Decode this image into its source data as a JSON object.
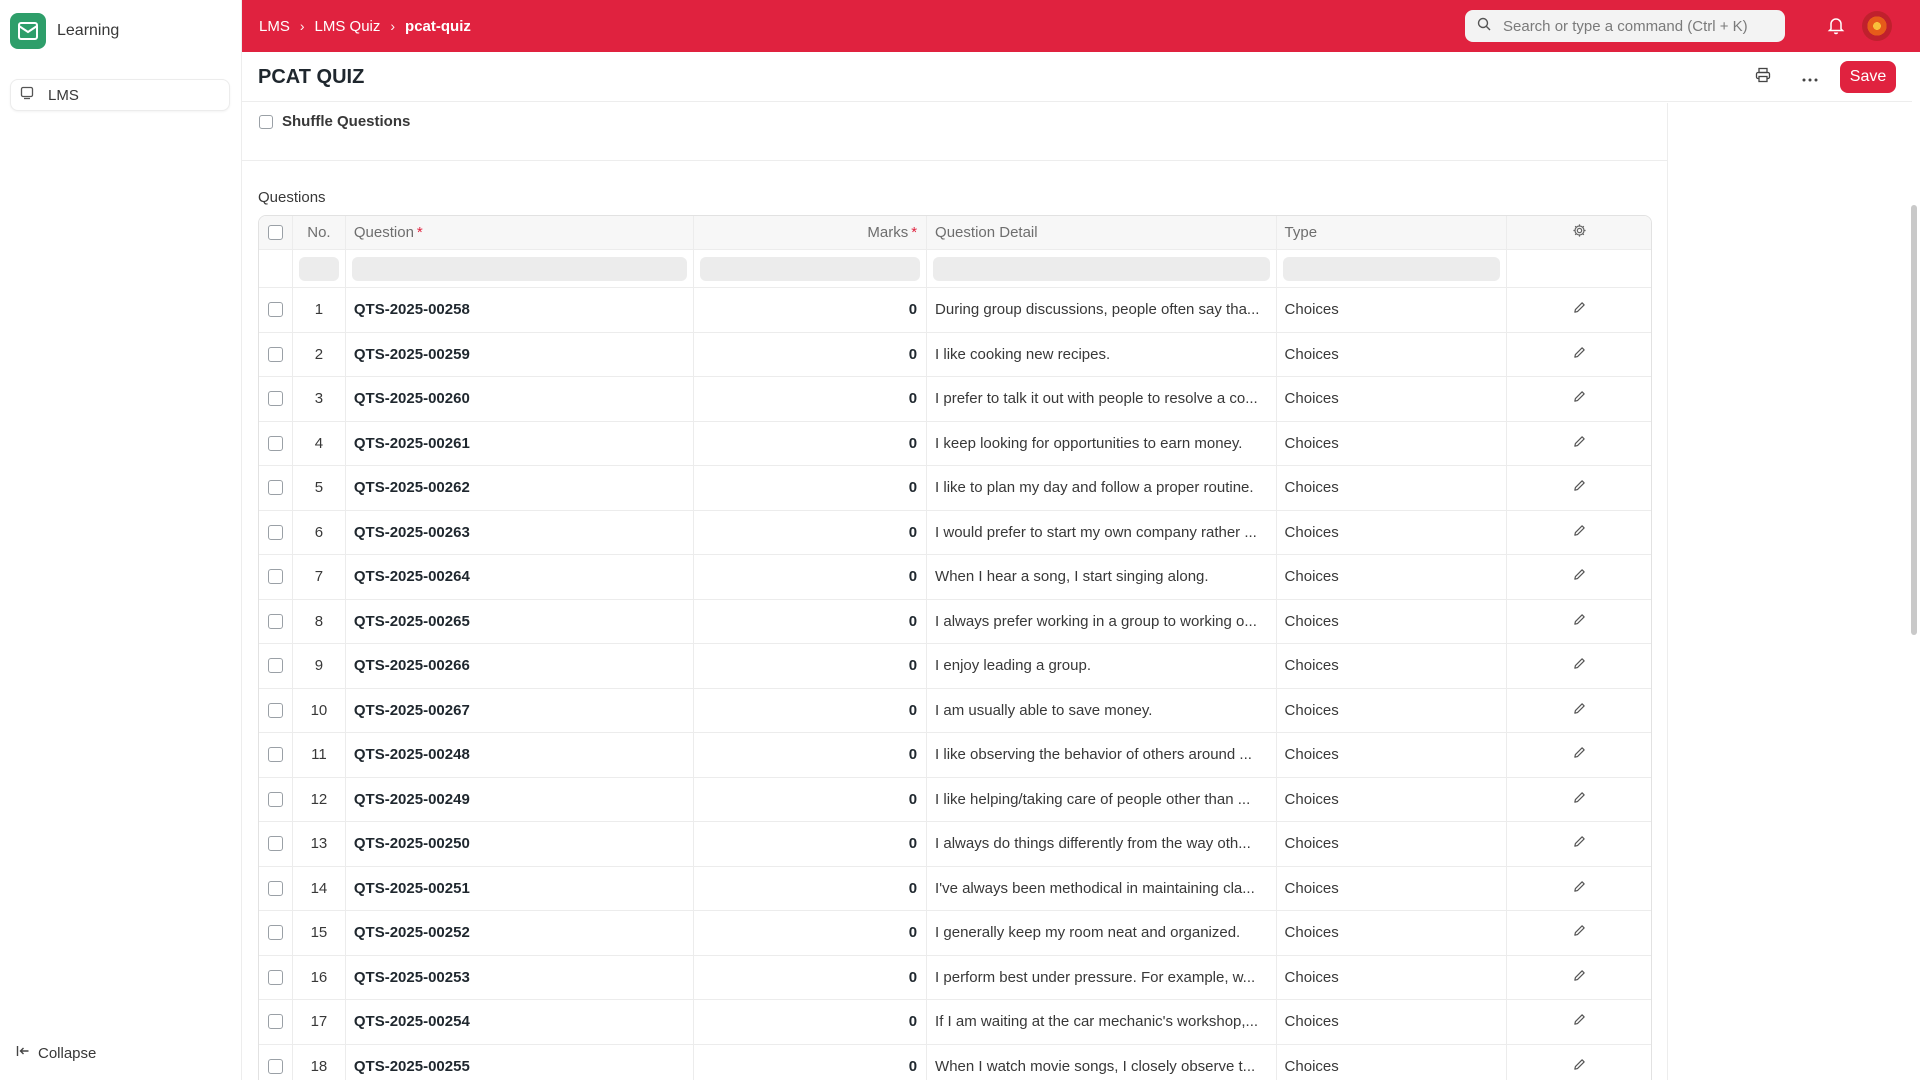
{
  "app": {
    "name": "Learning"
  },
  "sidebar": {
    "items": [
      {
        "label": "LMS",
        "icon": "workspace-icon"
      }
    ],
    "collapse_label": "Collapse"
  },
  "topbar": {
    "breadcrumb": [
      "LMS",
      "LMS Quiz",
      "pcat-quiz"
    ],
    "search_placeholder": "Search or type a command (Ctrl + K)",
    "accent_color": "#e0223f"
  },
  "page": {
    "title": "PCAT QUIZ",
    "save_label": "Save"
  },
  "form": {
    "shuffle_label": "Shuffle Questions",
    "shuffle_checked": false,
    "questions_label": "Questions"
  },
  "grid": {
    "columns": {
      "no": "No.",
      "question": "Question",
      "marks": "Marks",
      "detail": "Question Detail",
      "type": "Type"
    },
    "rows": [
      {
        "no": "1",
        "question": "QTS-2025-00258",
        "marks": "0",
        "detail": "During group discussions, people often say tha...",
        "type": "Choices"
      },
      {
        "no": "2",
        "question": "QTS-2025-00259",
        "marks": "0",
        "detail": "I like cooking new recipes.",
        "type": "Choices"
      },
      {
        "no": "3",
        "question": "QTS-2025-00260",
        "marks": "0",
        "detail": "I prefer to talk it out with people to resolve a co...",
        "type": "Choices"
      },
      {
        "no": "4",
        "question": "QTS-2025-00261",
        "marks": "0",
        "detail": "I keep looking for opportunities to earn money.",
        "type": "Choices"
      },
      {
        "no": "5",
        "question": "QTS-2025-00262",
        "marks": "0",
        "detail": "I like to plan my day and follow a proper routine.",
        "type": "Choices"
      },
      {
        "no": "6",
        "question": "QTS-2025-00263",
        "marks": "0",
        "detail": "I would prefer to start my own company rather ...",
        "type": "Choices"
      },
      {
        "no": "7",
        "question": "QTS-2025-00264",
        "marks": "0",
        "detail": "When I hear a song, I start singing along.",
        "type": "Choices"
      },
      {
        "no": "8",
        "question": "QTS-2025-00265",
        "marks": "0",
        "detail": "I always prefer working in a group to working o...",
        "type": "Choices"
      },
      {
        "no": "9",
        "question": "QTS-2025-00266",
        "marks": "0",
        "detail": "I enjoy leading a group.",
        "type": "Choices"
      },
      {
        "no": "10",
        "question": "QTS-2025-00267",
        "marks": "0",
        "detail": "I am usually able to save money.",
        "type": "Choices"
      },
      {
        "no": "11",
        "question": "QTS-2025-00248",
        "marks": "0",
        "detail": "I like observing the behavior of others around ...",
        "type": "Choices"
      },
      {
        "no": "12",
        "question": "QTS-2025-00249",
        "marks": "0",
        "detail": "I like helping/taking care of people other than ...",
        "type": "Choices"
      },
      {
        "no": "13",
        "question": "QTS-2025-00250",
        "marks": "0",
        "detail": "I always do things differently from the way oth...",
        "type": "Choices"
      },
      {
        "no": "14",
        "question": "QTS-2025-00251",
        "marks": "0",
        "detail": "I've always been methodical in maintaining cla...",
        "type": "Choices"
      },
      {
        "no": "15",
        "question": "QTS-2025-00252",
        "marks": "0",
        "detail": "I generally keep my room neat and organized.",
        "type": "Choices"
      },
      {
        "no": "16",
        "question": "QTS-2025-00253",
        "marks": "0",
        "detail": "I perform best under pressure. For example, w...",
        "type": "Choices"
      },
      {
        "no": "17",
        "question": "QTS-2025-00254",
        "marks": "0",
        "detail": "If I am waiting at the car mechanic's workshop,...",
        "type": "Choices"
      },
      {
        "no": "18",
        "question": "QTS-2025-00255",
        "marks": "0",
        "detail": "When I watch movie songs, I closely observe t...",
        "type": "Choices"
      }
    ]
  }
}
